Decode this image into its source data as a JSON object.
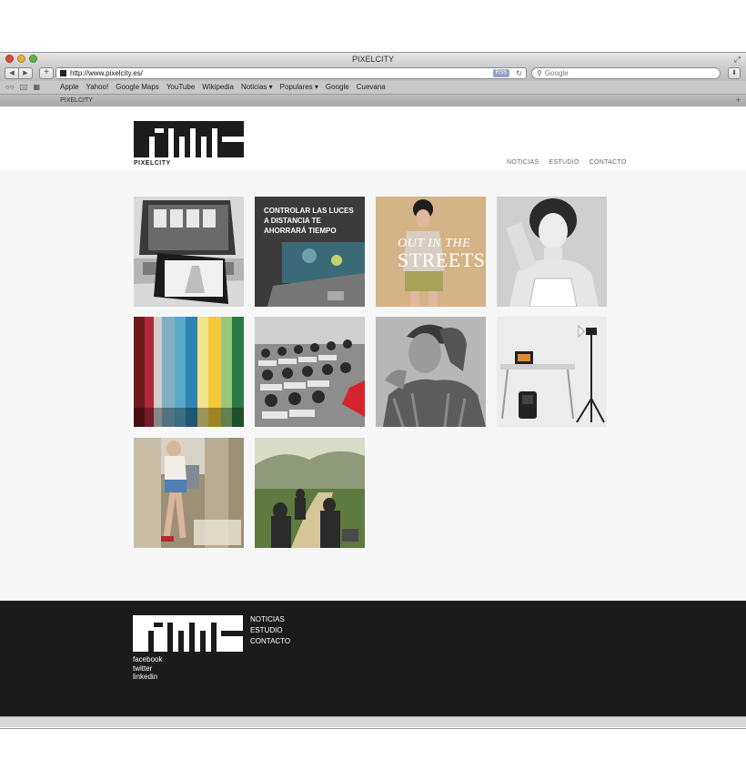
{
  "window": {
    "title": "PIXELCITY"
  },
  "toolbar": {
    "url": "http://www.pixelcity.es/",
    "rss_label": "RSS",
    "search_placeholder": "Google"
  },
  "bookmarks": [
    "Apple",
    "Yahoo!",
    "Google Maps",
    "YouTube",
    "Wikipedia",
    "Noticias ▾",
    "Populares ▾",
    "Google",
    "Cuevana"
  ],
  "tab": {
    "title": "PIXELCITY"
  },
  "site": {
    "brand": "PIXELCITY",
    "nav": [
      "NOTICIAS",
      "ESTUDIO",
      "CONTACTO"
    ]
  },
  "tiles": [
    {
      "name": "tile-laptop-tablet"
    },
    {
      "name": "tile-lights-article",
      "text": "CONTROLAR LAS LUCES A DISTANCIA TE AHORRARÁ TIEMPO"
    },
    {
      "name": "tile-out-in-the-streets",
      "text_top": "OUT IN THE",
      "text_bottom": "STREETS"
    },
    {
      "name": "tile-portrait-woman"
    },
    {
      "name": "tile-color-stripes"
    },
    {
      "name": "tile-classroom"
    },
    {
      "name": "tile-portrait-man"
    },
    {
      "name": "tile-studio-setup"
    },
    {
      "name": "tile-fashion-columns"
    },
    {
      "name": "tile-hikers"
    }
  ],
  "footer": {
    "nav": [
      "NOTICIAS",
      "ESTUDIO",
      "CONTACTO"
    ],
    "social": [
      "facebook",
      "twitter",
      "linkedin"
    ]
  }
}
